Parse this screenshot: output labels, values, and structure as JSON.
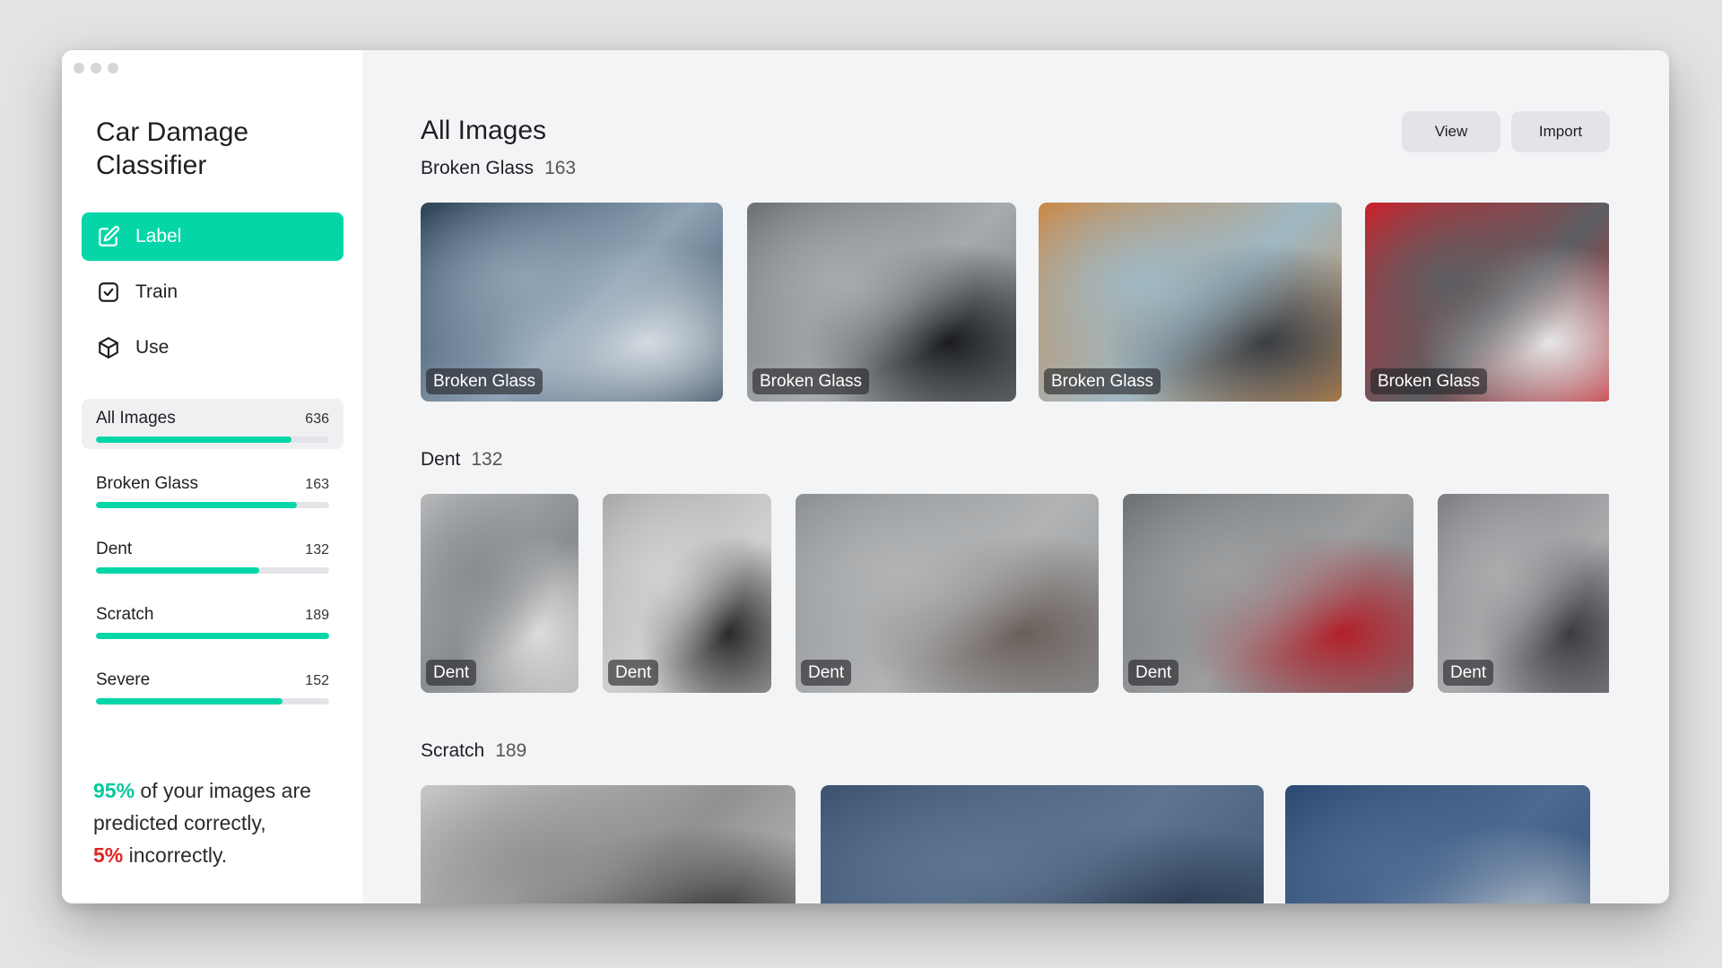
{
  "app": {
    "title": "Car Damage Classifier"
  },
  "nav": [
    {
      "label": "Label",
      "icon": "edit-icon",
      "active": true
    },
    {
      "label": "Train",
      "icon": "check-square-icon",
      "active": false
    },
    {
      "label": "Use",
      "icon": "cube-icon",
      "active": false
    }
  ],
  "categories": [
    {
      "name": "All Images",
      "count": "636",
      "progress": 0.84,
      "active": true
    },
    {
      "name": "Broken Glass",
      "count": "163",
      "progress": 0.86,
      "active": false
    },
    {
      "name": "Dent",
      "count": "132",
      "progress": 0.7,
      "active": false
    },
    {
      "name": "Scratch",
      "count": "189",
      "progress": 1.0,
      "active": false
    },
    {
      "name": "Severe",
      "count": "152",
      "progress": 0.8,
      "active": false
    }
  ],
  "stats": {
    "correct_pct": "95%",
    "line1_rest": " of your images are",
    "line2": "predicted correctly,",
    "incorrect_pct": "5%",
    "line3_rest": " incorrectly."
  },
  "main": {
    "title": "All Images",
    "buttons": {
      "view": "View",
      "import": "Import"
    }
  },
  "sections": [
    {
      "title": "Broken Glass",
      "count": "163",
      "images": [
        {
          "label": "Broken Glass",
          "palette": [
            "#2f4457",
            "#8fa3b5",
            "#d4dbe1"
          ]
        },
        {
          "label": "Broken Glass",
          "palette": [
            "#6e7276",
            "#a8abae",
            "#1a1c1f"
          ]
        },
        {
          "label": "Broken Glass",
          "palette": [
            "#c98a4b",
            "#9fb8c4",
            "#3a3d42"
          ]
        },
        {
          "label": "Broken Glass",
          "palette": [
            "#c8232c",
            "#5d5e62",
            "#e6e6e6"
          ]
        }
      ]
    },
    {
      "title": "Dent",
      "count": "132",
      "images": [
        {
          "label": "Dent",
          "palette": [
            "#b5b7b9",
            "#8a8d90",
            "#dcdcdc"
          ]
        },
        {
          "label": "Dent",
          "palette": [
            "#a7a9ab",
            "#cfd0d1",
            "#2a2a2c"
          ]
        },
        {
          "label": "Dent",
          "palette": [
            "#8e9193",
            "#b1b3b5",
            "#6a5f5a"
          ]
        },
        {
          "label": "Dent",
          "palette": [
            "#6f7274",
            "#9c9ea0",
            "#b3202a"
          ]
        },
        {
          "label": "Dent",
          "palette": [
            "#7d7f82",
            "#a9abad",
            "#3c3d40"
          ]
        }
      ]
    },
    {
      "title": "Scratch",
      "count": "189",
      "images": [
        {
          "label": "",
          "palette": [
            "#c5c6c8",
            "#8f9193",
            "#2b2b2d"
          ]
        },
        {
          "label": "",
          "palette": [
            "#3c5470",
            "#5e7591",
            "#243347"
          ]
        },
        {
          "label": "",
          "palette": [
            "#2d4a72",
            "#4d6a91",
            "#b8c3cc"
          ]
        }
      ]
    }
  ]
}
